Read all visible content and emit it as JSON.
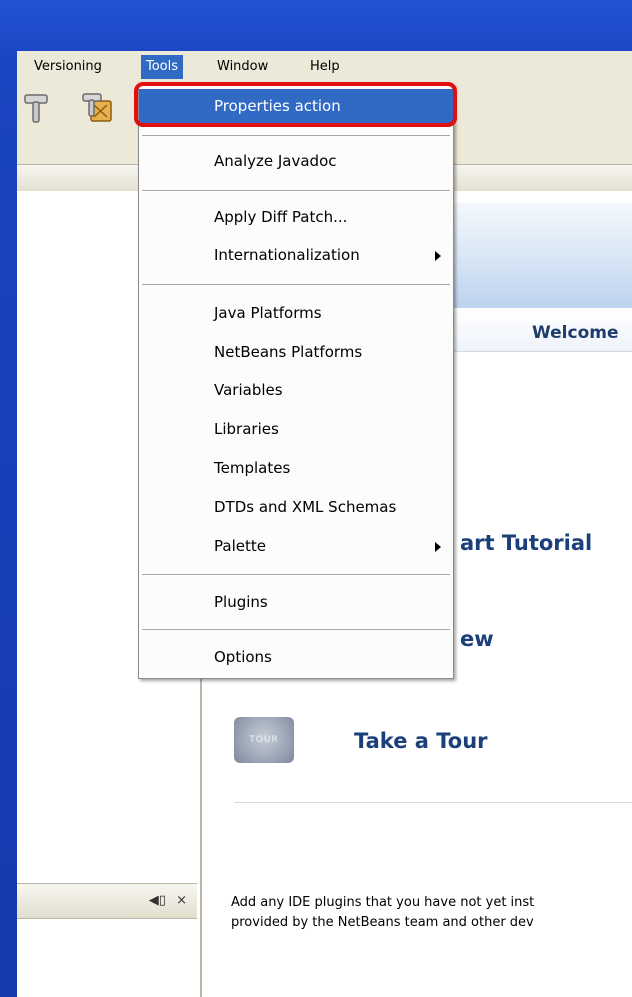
{
  "menubar": {
    "items": [
      {
        "label": "Versioning"
      },
      {
        "label": "Tools"
      },
      {
        "label": "Window"
      },
      {
        "label": "Help"
      }
    ]
  },
  "tools_menu": {
    "items": [
      {
        "label": "Properties action",
        "highlighted": true
      },
      {
        "label": "Analyze Javadoc"
      },
      {
        "label": "Apply Diff Patch..."
      },
      {
        "label": "Internationalization",
        "submenu": true
      },
      {
        "label": "Java Platforms"
      },
      {
        "label": "NetBeans Platforms"
      },
      {
        "label": "Variables"
      },
      {
        "label": "Libraries"
      },
      {
        "label": "Templates"
      },
      {
        "label": "DTDs and XML Schemas"
      },
      {
        "label": "Palette",
        "submenu": true
      },
      {
        "label": "Plugins"
      },
      {
        "label": "Options"
      }
    ]
  },
  "welcome": {
    "title": "Welcome",
    "link1": "art Tutorial",
    "link2": "ew",
    "link3": "Take a Tour",
    "tour_icon_label": "TOUR",
    "desc_line1": "Add any IDE plugins that you have not yet inst",
    "desc_line2": "provided by the NetBeans team and other dev"
  },
  "panel_controls": {
    "restore": "◀▯",
    "close": "×"
  },
  "colors": {
    "slide_bg": "#1a3fb0",
    "menu_highlight": "#316ac5",
    "callout_ring": "#e01010"
  },
  "icons": [
    "build-hammer-icon",
    "clean-build-icon",
    "submenu-arrow-icon"
  ]
}
